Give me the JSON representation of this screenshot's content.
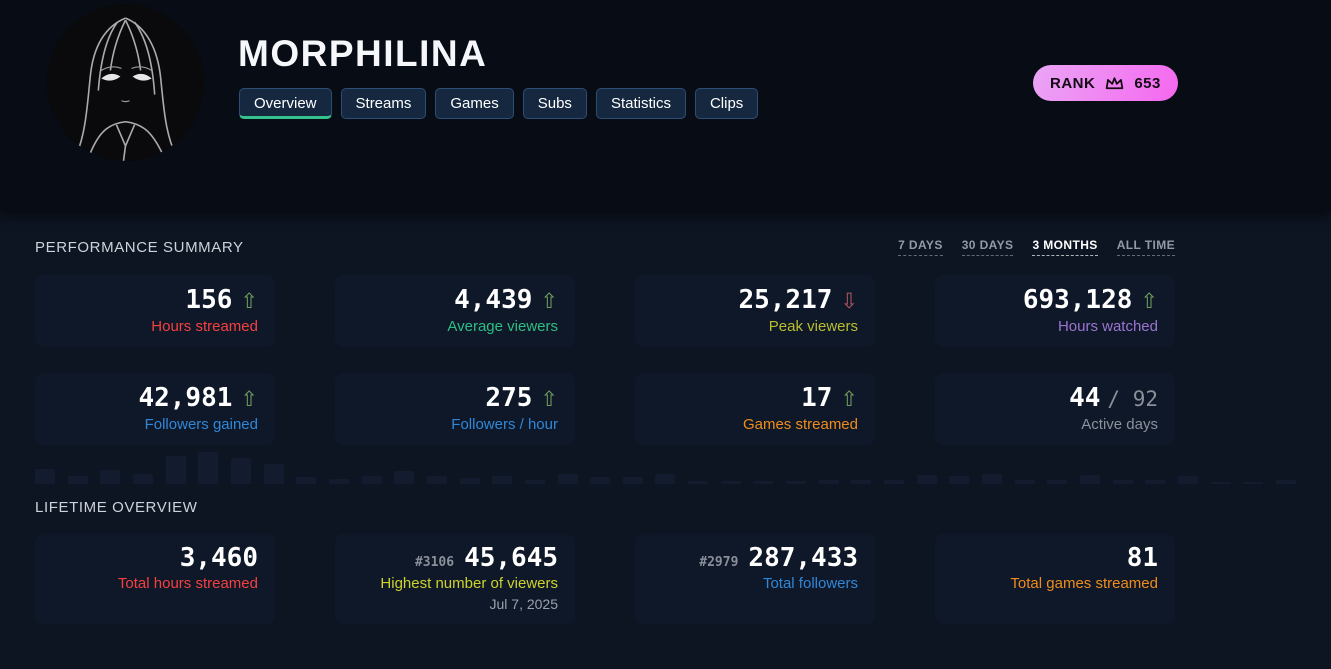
{
  "header": {
    "title": "MORPHILINA",
    "tabs": [
      {
        "label": "Overview"
      },
      {
        "label": "Streams"
      },
      {
        "label": "Games"
      },
      {
        "label": "Subs"
      },
      {
        "label": "Statistics"
      },
      {
        "label": "Clips"
      }
    ],
    "rank": {
      "label": "RANK",
      "value": "653"
    },
    "accent_active_tab": "#36c28e",
    "rank_gradient": [
      "#eaa6f6",
      "#f567ef"
    ]
  },
  "performance": {
    "section_title": "PERFORMANCE SUMMARY",
    "ranges": [
      {
        "label": "7 DAYS"
      },
      {
        "label": "30 DAYS"
      },
      {
        "label": "3 MONTHS",
        "active": true
      },
      {
        "label": "ALL TIME"
      }
    ],
    "cards": [
      {
        "value": "156",
        "arrow": "⇧",
        "arrow_color": "#6f9f5e",
        "label": "Hours streamed",
        "color": "#f54040"
      },
      {
        "value": "4,439",
        "arrow": "⇧",
        "arrow_color": "#6f9f5e",
        "label": "Average viewers",
        "color": "#2ebd85"
      },
      {
        "value": "25,217",
        "arrow": "⇩",
        "arrow_color": "#b25661",
        "label": "Peak viewers",
        "color": "#b9bd2e"
      },
      {
        "value": "693,128",
        "arrow": "⇧",
        "arrow_color": "#6f9f5e",
        "label": "Hours watched",
        "color": "#9b74d0"
      },
      {
        "value": "42,981",
        "arrow": "⇧",
        "arrow_color": "#6f9f5e",
        "label": "Followers gained",
        "color": "#3087d8"
      },
      {
        "value": "275",
        "arrow": "⇧",
        "arrow_color": "#6f9f5e",
        "label": "Followers / hour",
        "color": "#3087d8"
      },
      {
        "value": "17",
        "arrow": "⇧",
        "arrow_color": "#6f9f5e",
        "label": "Games streamed",
        "color": "#f08c1c"
      },
      {
        "value": "44",
        "suffix": "/ 92",
        "label": "Active days",
        "color": "#8b919c"
      }
    ]
  },
  "sparkline": {
    "bar_color": "#121c2e",
    "bars": [
      15,
      8,
      14,
      10,
      28,
      32,
      26,
      20,
      7,
      5,
      8,
      13,
      8,
      6,
      8,
      4,
      10,
      7,
      7,
      10,
      3,
      3,
      3,
      3,
      4,
      4,
      4,
      9,
      8,
      10,
      4,
      4,
      9,
      4,
      4,
      8,
      2,
      2,
      4
    ]
  },
  "lifetime": {
    "section_title": "LIFETIME OVERVIEW",
    "cards": [
      {
        "value": "3,460",
        "label": "Total hours streamed",
        "color": "#f54040"
      },
      {
        "rank": "#3106",
        "value": "45,645",
        "label": "Highest number of viewers",
        "sub": "Jul 7, 2025",
        "color": "#cdd32c"
      },
      {
        "rank": "#2979",
        "value": "287,433",
        "label": "Total followers",
        "color": "#3087d8"
      },
      {
        "value": "81",
        "label": "Total games streamed",
        "color": "#f08c1c"
      }
    ]
  }
}
